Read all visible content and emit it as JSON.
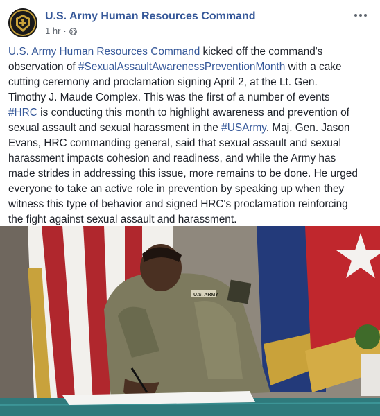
{
  "post": {
    "page_name": "U.S. Army Human Resources Command",
    "time": "1 hr",
    "dot": "·",
    "audience_icon": "globe-icon",
    "more_icon": "more-options-icon",
    "text_lines": [
      [
        {
          "t": "U.S. Army Human Resources Command",
          "link": true
        },
        {
          "t": " kicked off the command's"
        }
      ],
      [
        {
          "t": "observation of "
        },
        {
          "t": "#SexualAssaultAwarenessPreventionMonth",
          "link": true
        },
        {
          "t": " with a cake"
        }
      ],
      [
        {
          "t": "cutting ceremony and proclamation signing April 2, at the Lt. Gen."
        }
      ],
      [
        {
          "t": "Timothy J. Maude Complex. This was the first of a number of events"
        }
      ],
      [
        {
          "t": "#HRC",
          "link": true
        },
        {
          "t": " is conducting this month to highlight awareness and prevention of"
        }
      ],
      [
        {
          "t": "sexual assault and sexual harassment in the "
        },
        {
          "t": "#USArmy",
          "link": true
        },
        {
          "t": ". Maj. Gen. Jason"
        }
      ],
      [
        {
          "t": "Evans, HRC commanding general, said that sexual assault and sexual"
        }
      ],
      [
        {
          "t": "harassment impacts cohesion and readiness, and while the Army has"
        }
      ],
      [
        {
          "t": "made strides in addressing this issue, more remains to be done. He urged"
        }
      ],
      [
        {
          "t": "everyone to take an active role in prevention by speaking up when they"
        }
      ],
      [
        {
          "t": "witness this type of behavior and signed HRC's proclamation reinforcing"
        }
      ],
      [
        {
          "t": "the fight against sexual assault and harassment."
        }
      ]
    ],
    "photo_name_tape": "U.S. ARMY"
  },
  "colors": {
    "link": "#365899",
    "text": "#1d2129",
    "meta": "#616770"
  }
}
